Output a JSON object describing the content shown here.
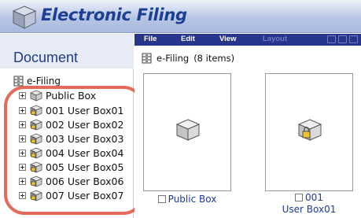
{
  "app": {
    "title": "Electronic Filing"
  },
  "sidebar": {
    "heading": "Document",
    "root_label": "e-Filing",
    "items": [
      {
        "label": "Public Box",
        "locked": false
      },
      {
        "label": "001 User Box01",
        "locked": true
      },
      {
        "label": "002 User Box02",
        "locked": true
      },
      {
        "label": "003 User Box03",
        "locked": true
      },
      {
        "label": "004 User Box04",
        "locked": true
      },
      {
        "label": "005 User Box05",
        "locked": true
      },
      {
        "label": "006 User Box06",
        "locked": true
      },
      {
        "label": "007 User Box07",
        "locked": true
      }
    ]
  },
  "toolbar": {
    "menu": [
      "File",
      "Edit",
      "View",
      "Layout"
    ],
    "disabled": [
      "Layout"
    ],
    "icons": [
      "copy-icon",
      "save-icon",
      "print-icon"
    ]
  },
  "main": {
    "path_label": "e-Filing",
    "item_count": "(8 items)",
    "cards": [
      {
        "caption_line1": "Public Box",
        "caption_line2": "",
        "locked": false
      },
      {
        "caption_line1": "001",
        "caption_line2": "User Box01",
        "locked": true
      }
    ]
  },
  "colors": {
    "header_title": "#1b3f92",
    "toolbar_bg": "#27358c",
    "highlight_ring": "#e46a5c",
    "link_text": "#1a3a9c"
  }
}
